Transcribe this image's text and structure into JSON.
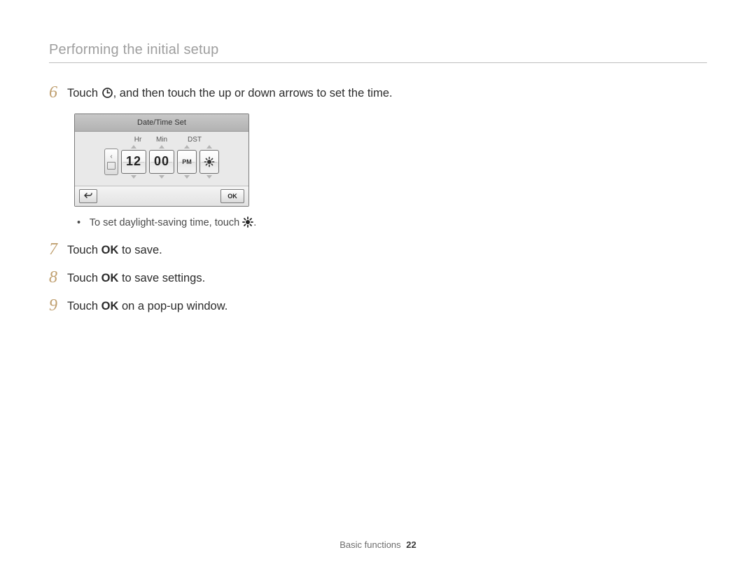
{
  "section_title": "Performing the initial setup",
  "steps": {
    "s6": {
      "num": "6",
      "pre": "Touch ",
      "post": ", and then touch the up or down arrows to set the time."
    },
    "s7": {
      "num": "7",
      "pre": "Touch ",
      "ok": "OK",
      "post": " to save."
    },
    "s8": {
      "num": "8",
      "pre": "Touch ",
      "ok": "OK",
      "post": " to save settings."
    },
    "s9": {
      "num": "9",
      "pre": "Touch ",
      "ok": "OK",
      "post": " on a pop-up window."
    }
  },
  "sub_bullet": {
    "pre": "To set daylight-saving time, touch ",
    "post": "."
  },
  "device": {
    "title": "Date/Time Set",
    "labels": {
      "hr": "Hr",
      "min": "Min",
      "dst": "DST"
    },
    "values": {
      "hr": "12",
      "min": "00",
      "ampm": "PM"
    },
    "ok": "OK"
  },
  "footer": {
    "section": "Basic functions",
    "page": "22"
  }
}
